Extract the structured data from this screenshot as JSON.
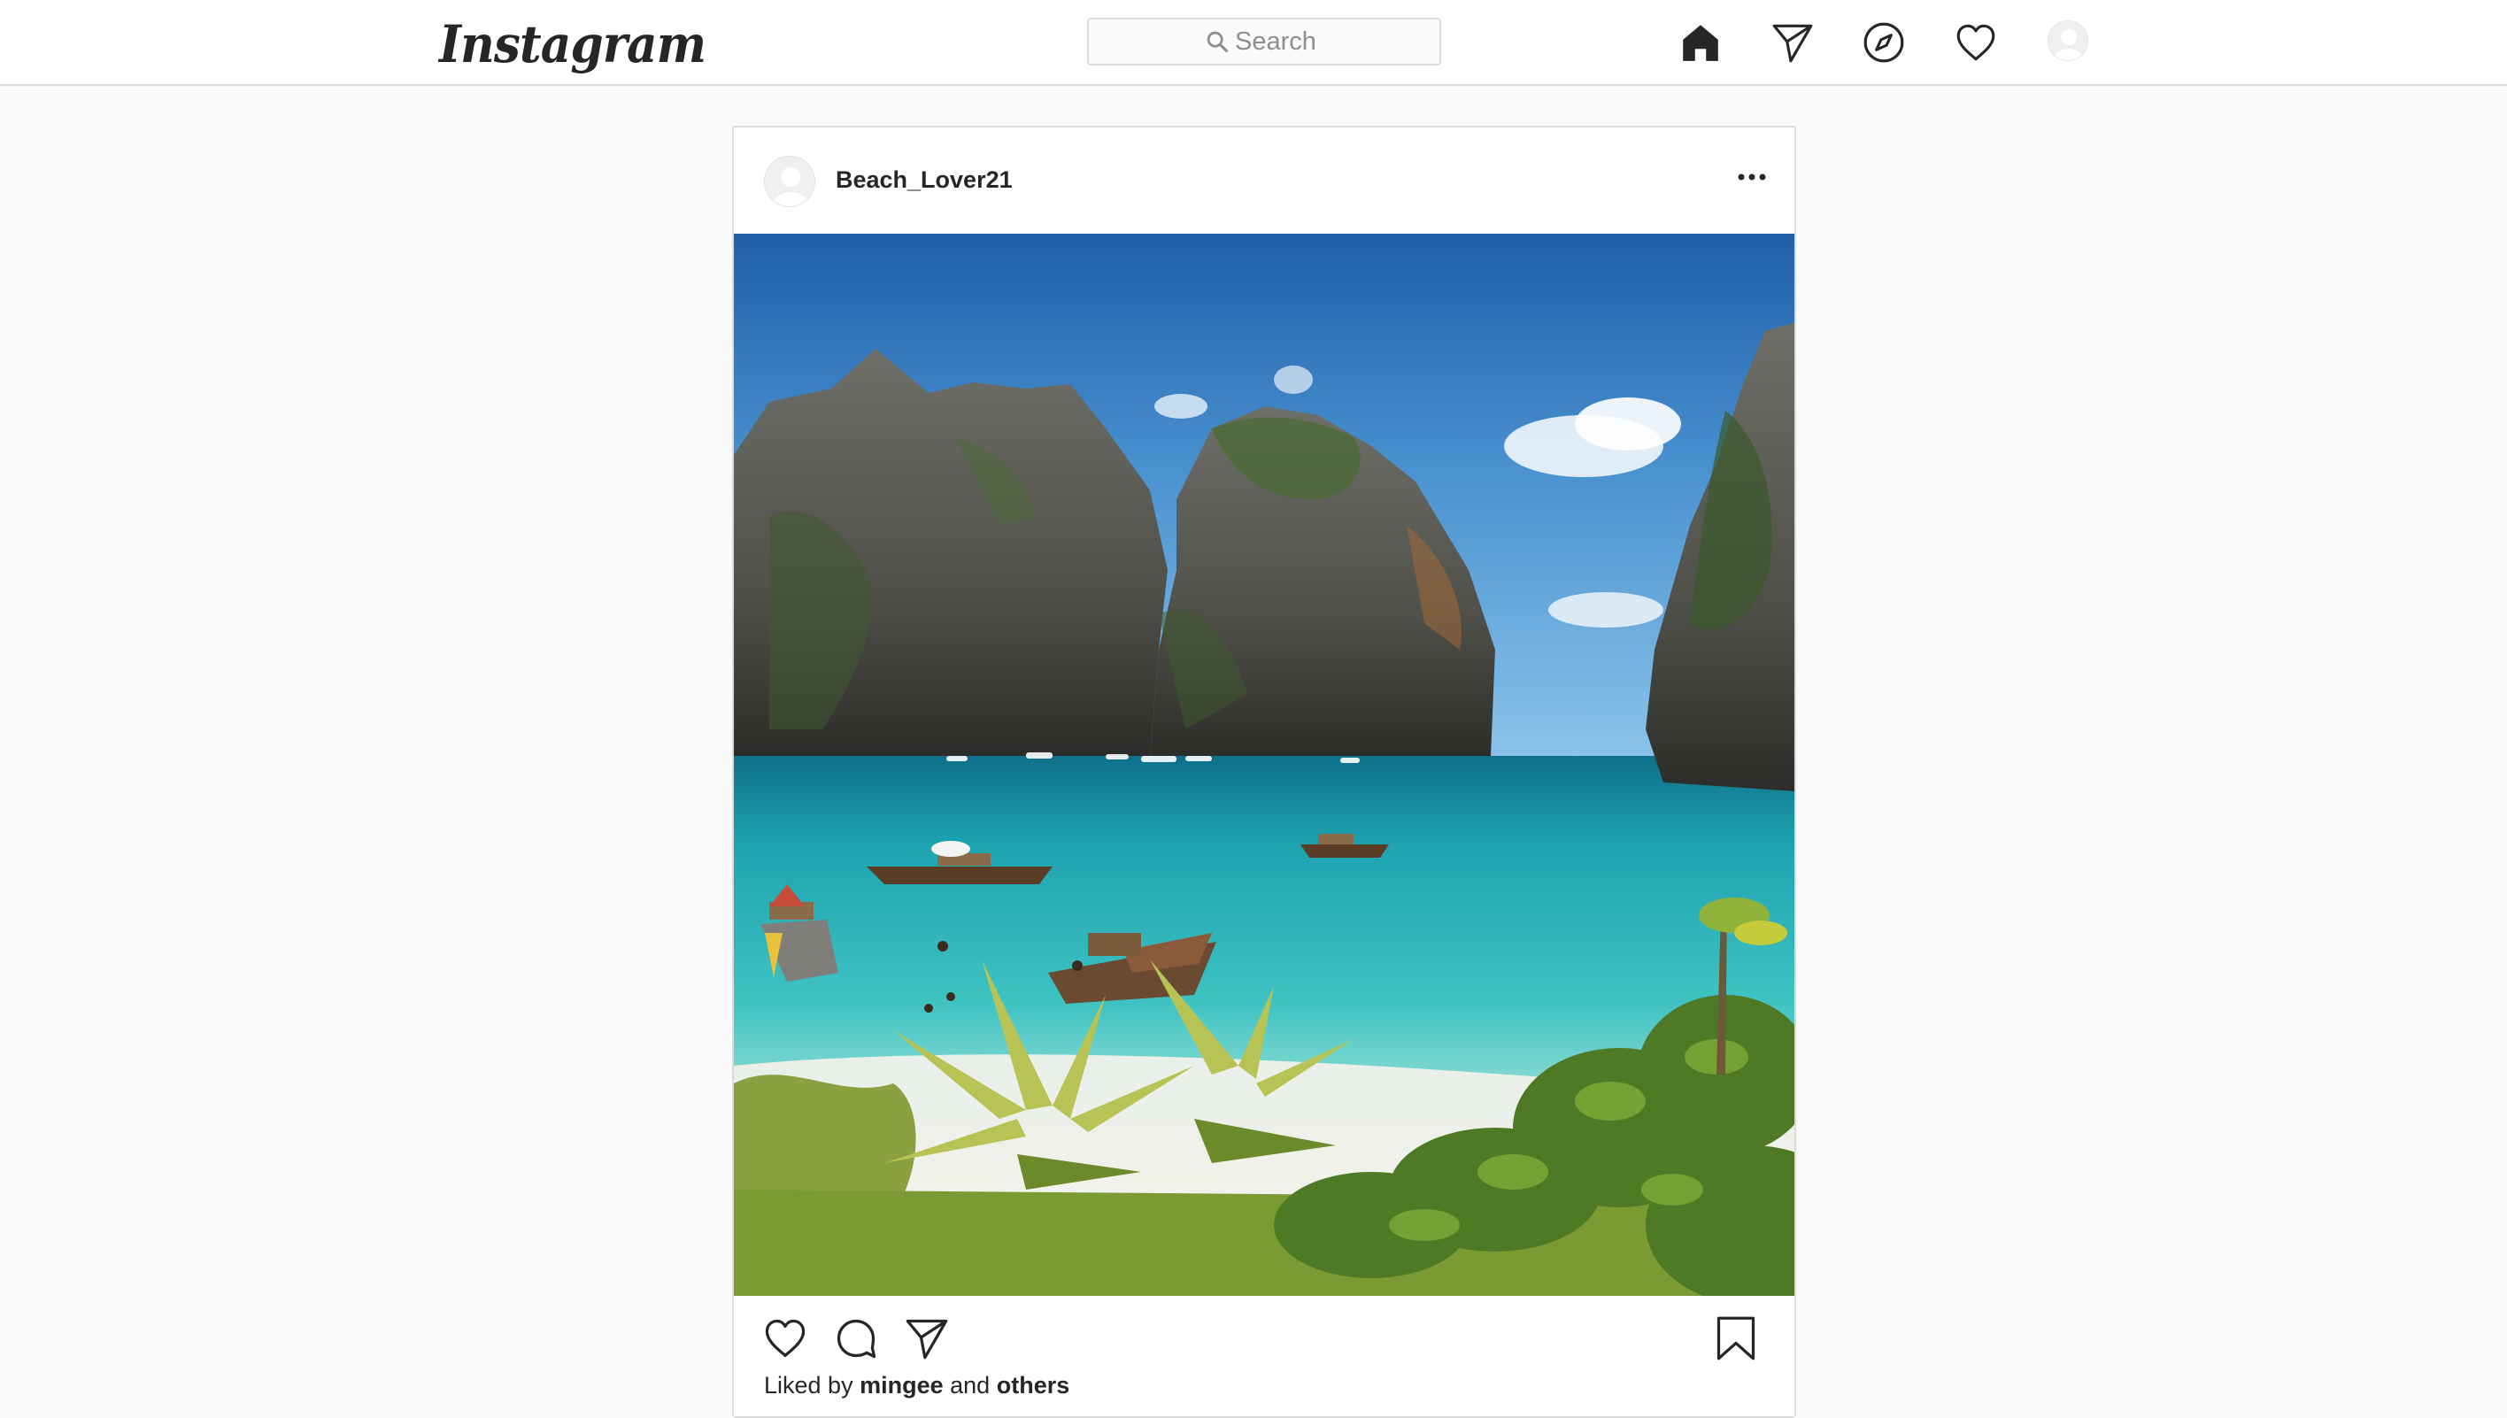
{
  "app": {
    "logo_text": "Instagram"
  },
  "search": {
    "placeholder": "Search"
  },
  "nav": {
    "icons": [
      "home-icon",
      "direct-icon",
      "explore-icon",
      "activity-icon",
      "profile-avatar"
    ]
  },
  "post": {
    "username": "Beach_Lover21",
    "liked_by_prefix": "Liked by",
    "liked_by_user": "mingee",
    "liked_by_joiner": "and",
    "liked_by_suffix": "others",
    "image_subject": "tropical bay with limestone cliffs, turquoise water and longtail boats"
  },
  "colors": {
    "background": "#fafafa",
    "card": "#ffffff",
    "border": "#dbdbdb",
    "text": "#262626",
    "muted": "#8e8e8e"
  }
}
